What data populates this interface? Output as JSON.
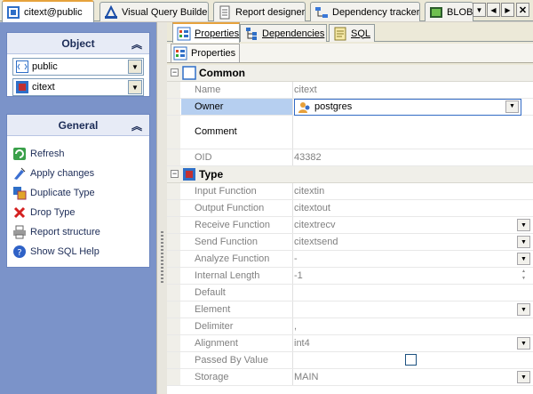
{
  "doc_tabs": [
    {
      "label": "citext@public",
      "icon": "type-editor-icon",
      "active": true
    },
    {
      "label": "Visual Query Builder",
      "icon": "query-builder-icon"
    },
    {
      "label": "Report designer",
      "icon": "report-designer-icon"
    },
    {
      "label": "Dependency tracker",
      "icon": "dependency-tracker-icon"
    },
    {
      "label": "BLOB Vi",
      "icon": "blob-viewer-icon"
    }
  ],
  "left": {
    "object_group": {
      "title": "Object",
      "schema": "public",
      "type": "citext"
    },
    "general_group": {
      "title": "General",
      "actions": [
        "Refresh",
        "Apply changes",
        "Duplicate Type",
        "Drop Type",
        "Report structure",
        "Show SQL Help"
      ]
    }
  },
  "sub_tabs": [
    {
      "label": "Properties",
      "active": true
    },
    {
      "label": "Dependencies"
    },
    {
      "label": "SQL"
    }
  ],
  "inspector_bar": {
    "label": "Properties"
  },
  "categories": {
    "common": "Common",
    "type": "Type"
  },
  "common_rows": [
    {
      "name": "Name",
      "value": "citext"
    },
    {
      "name": "Owner",
      "value": "postgres"
    },
    {
      "name": "Comment",
      "value": ""
    },
    {
      "name": "OID",
      "value": "43382"
    }
  ],
  "type_rows": [
    {
      "name": "Input Function",
      "value": "citextin"
    },
    {
      "name": "Output Function",
      "value": "citextout"
    },
    {
      "name": "Receive Function",
      "value": "citextrecv"
    },
    {
      "name": "Send Function",
      "value": "citextsend"
    },
    {
      "name": "Analyze Function",
      "value": "-"
    },
    {
      "name": "Internal Length",
      "value": "-1"
    },
    {
      "name": "Default",
      "value": ""
    },
    {
      "name": "Element",
      "value": ""
    },
    {
      "name": "Delimiter",
      "value": ","
    },
    {
      "name": "Alignment",
      "value": "int4"
    },
    {
      "name": "Passed By Value",
      "value": ""
    },
    {
      "name": "Storage",
      "value": "MAIN"
    }
  ],
  "colors": {
    "accent_tab": "#e6a23c",
    "panel": "#7b93c9",
    "selection": "#b6cff0"
  }
}
